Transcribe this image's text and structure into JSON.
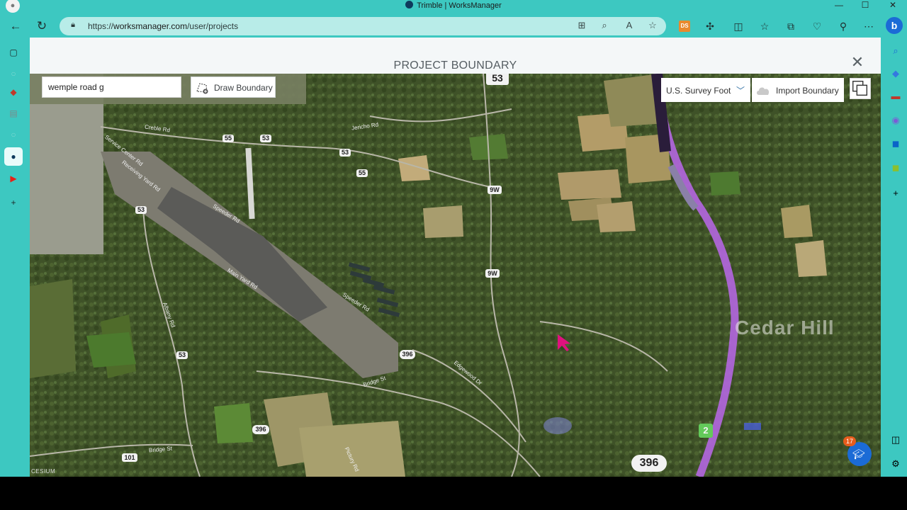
{
  "window": {
    "title": "Trimble | WorksManager",
    "controls": {
      "minimize": "—",
      "maximize": "☐",
      "close": "✕"
    }
  },
  "browser": {
    "url_prefix": "https://",
    "url_domain": "worksmanager.com",
    "url_path": "/user/projects",
    "toolbar_icons": [
      "back-icon",
      "refresh-icon",
      "apps-icon",
      "zoom-icon",
      "read-aloud-icon",
      "favorite-star-icon",
      "extension-ds-icon",
      "extensions-icon",
      "split-screen-icon",
      "favorites-icon",
      "collections-icon",
      "browser-essentials-icon",
      "performance-icon",
      "more-icon",
      "bing-copilot-icon"
    ],
    "ds_label": "DS"
  },
  "dialog": {
    "title": "PROJECT BOUNDARY",
    "close": "✕"
  },
  "map": {
    "search": {
      "value": "wemple road g",
      "placeholder": ""
    },
    "draw_boundary_label": "Draw Boundary",
    "unit_select_value": "U.S. Survey Foot",
    "import_boundary_label": "Import Boundary",
    "attribution": "CESIUM",
    "place_label": "Cedar Hill",
    "route_shields": [
      "53",
      "55",
      "53",
      "53",
      "55",
      "9W",
      "9W",
      "53",
      "53",
      "396",
      "396",
      "101",
      "396",
      "2"
    ],
    "road_labels": [
      "Creble Rd",
      "Jericho Rd",
      "Service Center Rd",
      "Receiving Yard Rd",
      "Speeder Rd",
      "Main Yard Rd",
      "Speeder Rd",
      "Albany Rd",
      "Bridge St",
      "Edgewood Dr",
      "Bridge St",
      "Pictury Rd"
    ]
  },
  "notification": {
    "count": "17"
  },
  "colors": {
    "browser_bg": "#3dc8c1",
    "address_bar": "#b8ece8",
    "boundary_line": "#b466e0",
    "edge_blue": "#1b6bd6"
  }
}
